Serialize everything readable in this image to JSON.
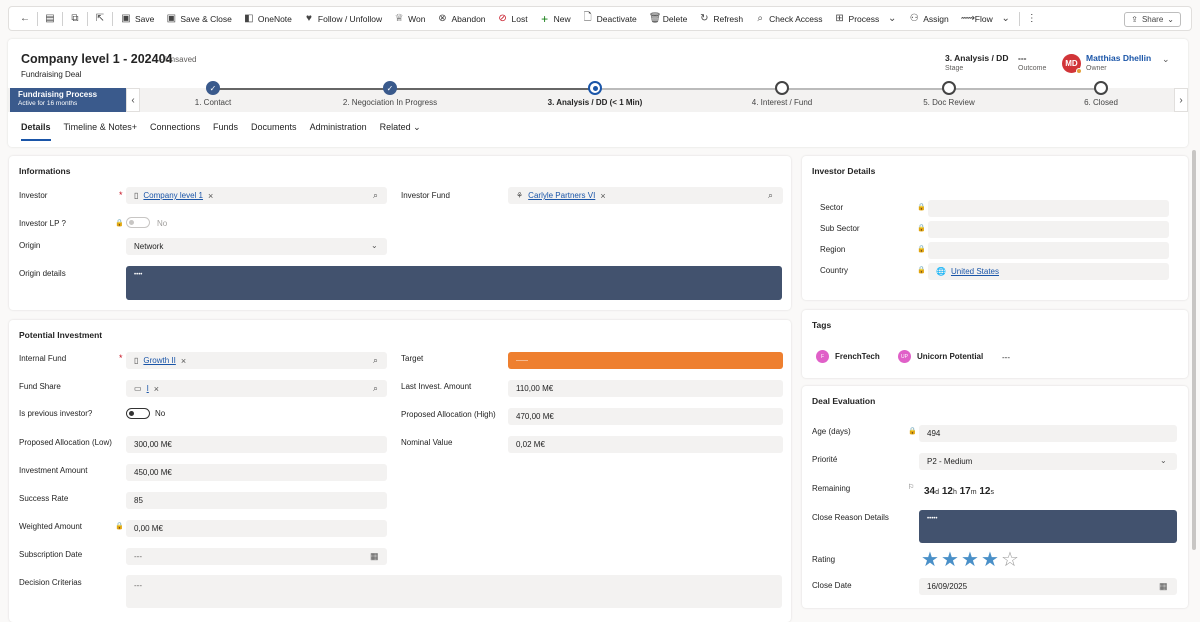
{
  "toolbar": {
    "save": "Save",
    "save_close": "Save & Close",
    "onenote": "OneNote",
    "follow": "Follow / Unfollow",
    "won": "Won",
    "abandon": "Abandon",
    "lost": "Lost",
    "new": "New",
    "deactivate": "Deactivate",
    "delete": "Delete",
    "refresh": "Refresh",
    "check_access": "Check Access",
    "process": "Process",
    "assign": "Assign",
    "flow": "Flow",
    "share": "Share"
  },
  "header": {
    "title": "Company level 1 - 202404",
    "unsaved": "- Unsaved",
    "entity": "Fundraising Deal",
    "stage_value": "3. Analysis / DD",
    "stage_label": "Stage",
    "outcome_value": "---",
    "outcome_label": "Outcome",
    "owner_initials": "MD",
    "owner_name": "Matthias Dhellin",
    "owner_label": "Owner"
  },
  "bpf": {
    "name": "Fundraising Process",
    "status": "Active for 16 months",
    "stages": [
      {
        "label": "1. Contact",
        "state": "done"
      },
      {
        "label": "2. Negociation In Progress",
        "state": "done"
      },
      {
        "label": "3. Analysis / DD",
        "duration": "(< 1 Min)",
        "state": "active"
      },
      {
        "label": "4. Interest / Fund",
        "state": "todo"
      },
      {
        "label": "5. Doc Review",
        "state": "todo"
      },
      {
        "label": "6. Closed",
        "state": "todo"
      }
    ]
  },
  "tabs": [
    "Details",
    "Timeline & Notes+",
    "Connections",
    "Funds",
    "Documents",
    "Administration",
    "Related"
  ],
  "informations": {
    "title": "Informations",
    "investor_label": "Investor",
    "investor_value": "Company level 1",
    "investor_fund_label": "Investor Fund",
    "investor_fund_value": "Carlyle Partners VI",
    "investor_lp_label": "Investor LP ?",
    "investor_lp_value": "No",
    "origin_label": "Origin",
    "origin_value": "Network",
    "origin_details_label": "Origin details",
    "origin_details_value": "••••"
  },
  "potential": {
    "title": "Potential Investment",
    "internal_fund_label": "Internal Fund",
    "internal_fund_value": "Growth II",
    "fund_share_label": "Fund Share",
    "fund_share_value": "I",
    "prev_investor_label": "Is previous investor?",
    "prev_investor_value": "No",
    "alloc_low_label": "Proposed Allocation (Low)",
    "alloc_low_value": "300,00 M€",
    "invest_amount_label": "Investment Amount",
    "invest_amount_value": "450,00 M€",
    "success_rate_label": "Success Rate",
    "success_rate_value": "85",
    "weighted_label": "Weighted Amount",
    "weighted_value": "0,00 M€",
    "subscription_label": "Subscription Date",
    "subscription_value": "---",
    "decision_label": "Decision Criterias",
    "decision_value": "---",
    "target_label": "Target",
    "target_value": "——",
    "last_invest_label": "Last Invest. Amount",
    "last_invest_value": "110,00 M€",
    "alloc_high_label": "Proposed Allocation (High)",
    "alloc_high_value": "470,00 M€",
    "nominal_label": "Nominal Value",
    "nominal_value": "0,02 M€"
  },
  "investor_details": {
    "title": "Investor Details",
    "sector_label": "Sector",
    "subsector_label": "Sub Sector",
    "region_label": "Region",
    "country_label": "Country",
    "country_value": "United States"
  },
  "tags": {
    "title": "Tags",
    "items": [
      {
        "initials": "F",
        "label": "FrenchTech"
      },
      {
        "initials": "UP",
        "label": "Unicorn Potential"
      }
    ],
    "more": "---"
  },
  "evaluation": {
    "title": "Deal Evaluation",
    "age_label": "Age (days)",
    "age_value": "494",
    "priority_label": "Priorité",
    "priority_value": "P2 - Medium",
    "remaining_label": "Remaining",
    "remaining_d": "34",
    "remaining_h": "12",
    "remaining_m": "17",
    "remaining_s": "12",
    "close_reason_label": "Close Reason Details",
    "close_reason_value": "•••••",
    "rating_label": "Rating",
    "rating": 4,
    "rating_max": 5,
    "close_date_label": "Close Date",
    "close_date_value": "16/09/2025"
  }
}
